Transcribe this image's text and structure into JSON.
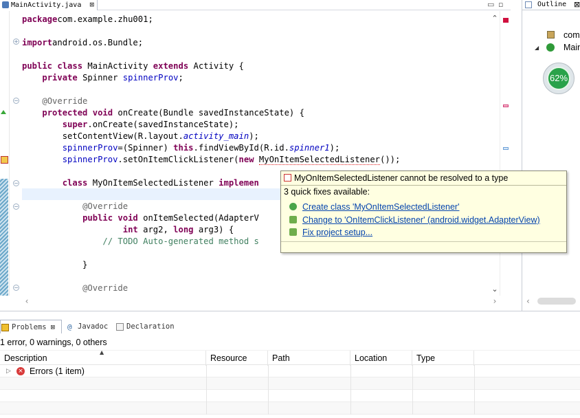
{
  "editor": {
    "tab_label": "MainActivity.java",
    "tab_close": "⊠",
    "minimize": "▭",
    "maximize": "▫",
    "lines": [
      {
        "parts": [
          [
            "kw",
            "package"
          ],
          [
            "",
            "com.example.zhu001;"
          ]
        ]
      },
      {
        "parts": [
          [
            "kw",
            "import"
          ],
          [
            "",
            "android.os.Bundle;"
          ]
        ]
      },
      {
        "parts": [
          [
            "kw",
            "public class"
          ],
          [
            "",
            " MainActivity "
          ],
          [
            "kw",
            "extends"
          ],
          [
            "",
            " Activity {"
          ]
        ]
      },
      {
        "parts": [
          [
            "",
            "    "
          ],
          [
            "kw",
            "private"
          ],
          [
            "",
            " Spinner "
          ],
          [
            "fld",
            "spinnerProv"
          ],
          [
            "",
            ";"
          ]
        ]
      },
      {
        "parts": [
          [
            "",
            "    "
          ],
          [
            "ann",
            "@Override"
          ]
        ]
      },
      {
        "parts": [
          [
            "",
            "    "
          ],
          [
            "kw",
            "protected void"
          ],
          [
            "",
            " onCreate(Bundle savedInstanceState) {"
          ]
        ]
      },
      {
        "parts": [
          [
            "",
            "        "
          ],
          [
            "kw",
            "super"
          ],
          [
            "",
            ".onCreate(savedInstanceState);"
          ]
        ]
      },
      {
        "parts": [
          [
            "",
            "        setContentView(R.layout."
          ],
          [
            "ital",
            "activity_main"
          ],
          [
            "",
            ");"
          ]
        ]
      },
      {
        "parts": [
          [
            "",
            "        "
          ],
          [
            "fld",
            "spinnerProv"
          ],
          [
            "",
            "=(Spinner) "
          ],
          [
            "kw",
            "this"
          ],
          [
            "",
            ".findViewById(R.id."
          ],
          [
            "ital",
            "spinner1"
          ],
          [
            "",
            ");"
          ]
        ]
      },
      {
        "parts": [
          [
            "",
            "        "
          ],
          [
            "fld",
            "spinnerProv"
          ],
          [
            "",
            ".setOnItemClickListener("
          ],
          [
            "kw",
            "new"
          ],
          [
            "",
            " "
          ],
          [
            "err",
            "MyOnItemSelectedListener"
          ],
          [
            "",
            "());"
          ]
        ]
      },
      {
        "parts": [
          [
            "",
            "        "
          ],
          [
            "kw",
            "class"
          ],
          [
            "",
            " MyOnItemSelectedListener "
          ],
          [
            "kw",
            "implemen"
          ]
        ]
      },
      {
        "parts": [
          [
            "",
            "            "
          ],
          [
            "ann",
            "@Override"
          ]
        ]
      },
      {
        "parts": [
          [
            "",
            "            "
          ],
          [
            "kw",
            "public void"
          ],
          [
            "",
            " onItemSelected(AdapterV"
          ]
        ]
      },
      {
        "parts": [
          [
            "",
            "                    "
          ],
          [
            "kw",
            "int"
          ],
          [
            "",
            " arg2, "
          ],
          [
            "kw",
            "long"
          ],
          [
            "",
            " arg3) {"
          ]
        ]
      },
      {
        "parts": [
          [
            "",
            "                "
          ],
          [
            "cmt",
            "// TODO Auto-generated method s"
          ]
        ]
      },
      {
        "parts": [
          [
            "",
            "            }"
          ]
        ]
      },
      {
        "parts": [
          [
            "",
            "            "
          ],
          [
            "ann",
            "@Override"
          ]
        ]
      }
    ]
  },
  "outline": {
    "tab_label": "Outline",
    "tab_close": "⊠",
    "items": [
      {
        "label": "com"
      },
      {
        "label": "Main"
      }
    ],
    "gauge_value": "62%"
  },
  "quickfix": {
    "title": "MyOnItemSelectedListener cannot be resolved to a type",
    "count_text": "3 quick fixes available:",
    "fixes": [
      {
        "label": "Create class 'MyOnItemSelectedListener'",
        "icon": "create-class-icon"
      },
      {
        "label": "Change to 'OnItemClickListener' (android.widget.AdapterView)",
        "icon": "change-icon"
      },
      {
        "label": "Fix project setup...",
        "icon": "fix-setup-icon"
      }
    ]
  },
  "problems": {
    "tabs": [
      {
        "label": "Problems",
        "close": "⊠",
        "icon": "problems-icon"
      },
      {
        "label": "Javadoc",
        "icon": "javadoc-icon"
      },
      {
        "label": "Declaration",
        "icon": "declaration-icon"
      }
    ],
    "summary": "1 error, 0 warnings, 0 others",
    "columns": [
      "Description",
      "Resource",
      "Path",
      "Location",
      "Type"
    ],
    "rows": [
      {
        "label": "Errors (1 item)",
        "icon": "error-icon"
      }
    ]
  },
  "colors": {
    "keyword": "#7f0055",
    "field": "#0000c0",
    "comment": "#3f7f5f",
    "popup_bg": "#ffffe1",
    "link": "#0645ad",
    "error": "#d83a3a",
    "gauge": "#2aa24a"
  }
}
